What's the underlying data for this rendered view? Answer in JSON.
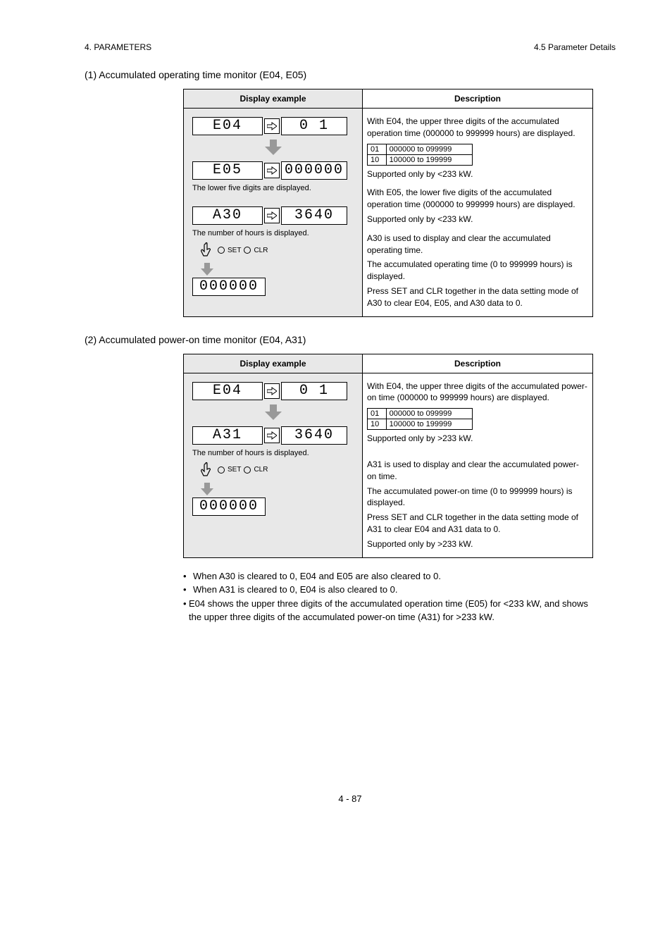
{
  "header": {
    "left": "4. PARAMETERS",
    "right": "4.5 Parameter Details"
  },
  "sections": [
    {
      "title_label": "(1)",
      "title": "Accumulated operating time monitor (E04, E05)",
      "left_head": "Display example",
      "right_head": "Description",
      "rows": [
        {
          "code": "E04",
          "value": "0 1",
          "right_paras": [
            "With E04, the upper three digits of the accumulated operation time (000000 to 999999 hours) are displayed.",
            "Supported only by <233 kW."
          ],
          "ref": [
            {
              "dig": "01",
              "text": "000000 to 099999"
            },
            {
              "dig": "10",
              "text": "100000 to 199999"
            }
          ]
        },
        {
          "code": "E05",
          "value": "000000",
          "note": "The lower five digits are displayed.",
          "right_paras": [
            "With E05, the lower five digits of the accumulated operation time (000000 to 999999 hours) are displayed.",
            "Supported only by <233 kW."
          ]
        },
        {
          "code": "A30",
          "value": "3640",
          "note": "The number of hours is displayed.",
          "keys": {
            "label1": "SET",
            "label2": "CLR"
          },
          "result": "000000",
          "right_paras": [
            "A30 is used to display and clear the accumulated operating time.",
            "The accumulated operating time (0 to 999999 hours) is displayed.",
            "Press SET and CLR together in the data setting mode of A30 to clear E04, E05, and A30 data to 0."
          ]
        }
      ]
    },
    {
      "title_label": "(2)",
      "title": "Accumulated power-on time monitor (E04, A31)",
      "left_head": "Display example",
      "right_head": "Description",
      "rows": [
        {
          "code": "E04",
          "value": "0 1",
          "right_paras": [
            "With E04, the upper three digits of the accumulated power-on time (000000 to 999999 hours) are displayed.",
            "Supported only by >233 kW."
          ],
          "ref": [
            {
              "dig": "01",
              "text": "000000 to 099999"
            },
            {
              "dig": "10",
              "text": "100000 to 199999"
            }
          ]
        },
        {
          "code": "A31",
          "value": "3640",
          "note": "The number of hours is displayed.",
          "keys": {
            "label1": "SET",
            "label2": "CLR"
          },
          "result": "000000",
          "right_paras": [
            "A31 is used to display and clear the accumulated power-on time.",
            "The accumulated power-on time (0 to 999999 hours) is displayed.",
            "Press SET and CLR together in the data setting mode of A31 to clear E04 and A31 data to 0.",
            "Supported only by >233 kW."
          ]
        }
      ]
    }
  ],
  "bullets": [
    "When A30 is cleared to 0, E04 and E05 are also cleared to 0.",
    "When A31 is cleared to 0, E04 is also cleared to 0.",
    "E04 shows the upper three digits of the accumulated operation time (E05) for <233 kW, and shows the upper three digits of the accumulated power-on time (A31) for >233 kW."
  ],
  "footer": "4 - 87"
}
